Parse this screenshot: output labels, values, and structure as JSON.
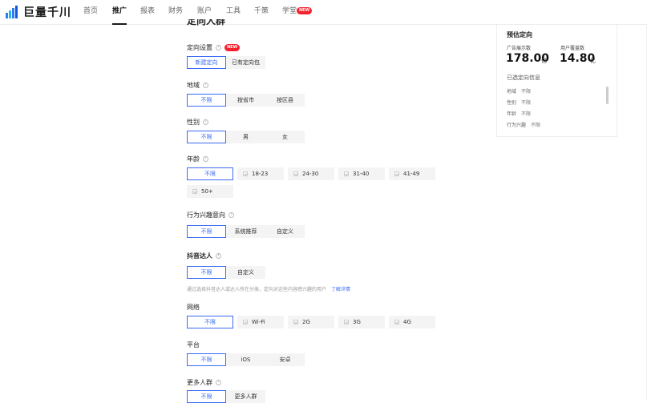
{
  "brand": {
    "name": "巨量千川"
  },
  "nav": [
    {
      "label": "首页"
    },
    {
      "label": "推广"
    },
    {
      "label": "报表"
    },
    {
      "label": "财务"
    },
    {
      "label": "账户"
    },
    {
      "label": "工具"
    },
    {
      "label": "千策"
    },
    {
      "label": "学堂",
      "badge": "NEW"
    }
  ],
  "form": {
    "heading": "定向人群",
    "targeting": {
      "label": "定向设置",
      "badge": "NEW",
      "options": [
        "新建定向",
        "已有定向包"
      ]
    },
    "region": {
      "label": "地域",
      "options": [
        "不限",
        "按省市",
        "按区县"
      ]
    },
    "gender": {
      "label": "性别",
      "options": [
        "不限",
        "男",
        "女"
      ]
    },
    "age": {
      "label": "年龄",
      "options": [
        "不限",
        "18-23",
        "24-30",
        "31-40",
        "41-49",
        "50+"
      ]
    },
    "interest": {
      "label": "行为兴趣意向",
      "options": [
        "不限",
        "系统推荐",
        "自定义"
      ]
    },
    "douyin": {
      "label": "抖音达人",
      "options": [
        "不限",
        "自定义"
      ],
      "hint": "通过选择抖音达人或达人所在分类，定向对这些内容感兴趣的用户",
      "hint_link": "了解详情"
    },
    "network": {
      "label": "网络",
      "options": [
        "不限",
        "Wi-Fi",
        "2G",
        "3G",
        "4G"
      ]
    },
    "platform": {
      "label": "平台",
      "options": [
        "不限",
        "iOS",
        "安卓"
      ]
    },
    "more": {
      "label": "更多人群",
      "options": [
        "不限",
        "更多人群"
      ]
    }
  },
  "estimate": {
    "title": "预估定向",
    "ad_impressions_label": "广告展示数",
    "ad_impressions_value": "178.00",
    "ad_impressions_unit": "亿",
    "user_coverage_label": "用户覆盖数",
    "user_coverage_value": "14.80",
    "user_coverage_unit": "亿",
    "selected_title": "已选定向信息",
    "selected": [
      {
        "key": "地域",
        "value": "不限"
      },
      {
        "key": "性别",
        "value": "不限"
      },
      {
        "key": "年龄",
        "value": "不限"
      },
      {
        "key": "行为兴趣",
        "value": "不限"
      }
    ]
  },
  "colors": {
    "accent": "#3b6cf5",
    "badge": "#f5222d"
  }
}
